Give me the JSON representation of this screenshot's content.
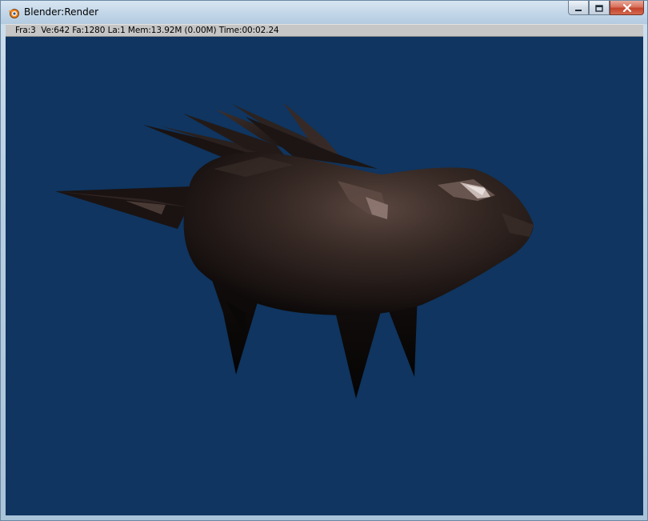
{
  "window": {
    "title": "Blender:Render",
    "icon": "blender-icon",
    "controls": {
      "minimize": "minimize-icon",
      "maximize": "maximize-icon",
      "close": "close-icon"
    }
  },
  "status": {
    "text": "Fra:3  Ve:642 Fa:1280 La:1 Mem:13.92M (0.00M) Time:00:02.24"
  },
  "render": {
    "background_color": "#0f3560",
    "object_color": "#2a1f1b"
  }
}
